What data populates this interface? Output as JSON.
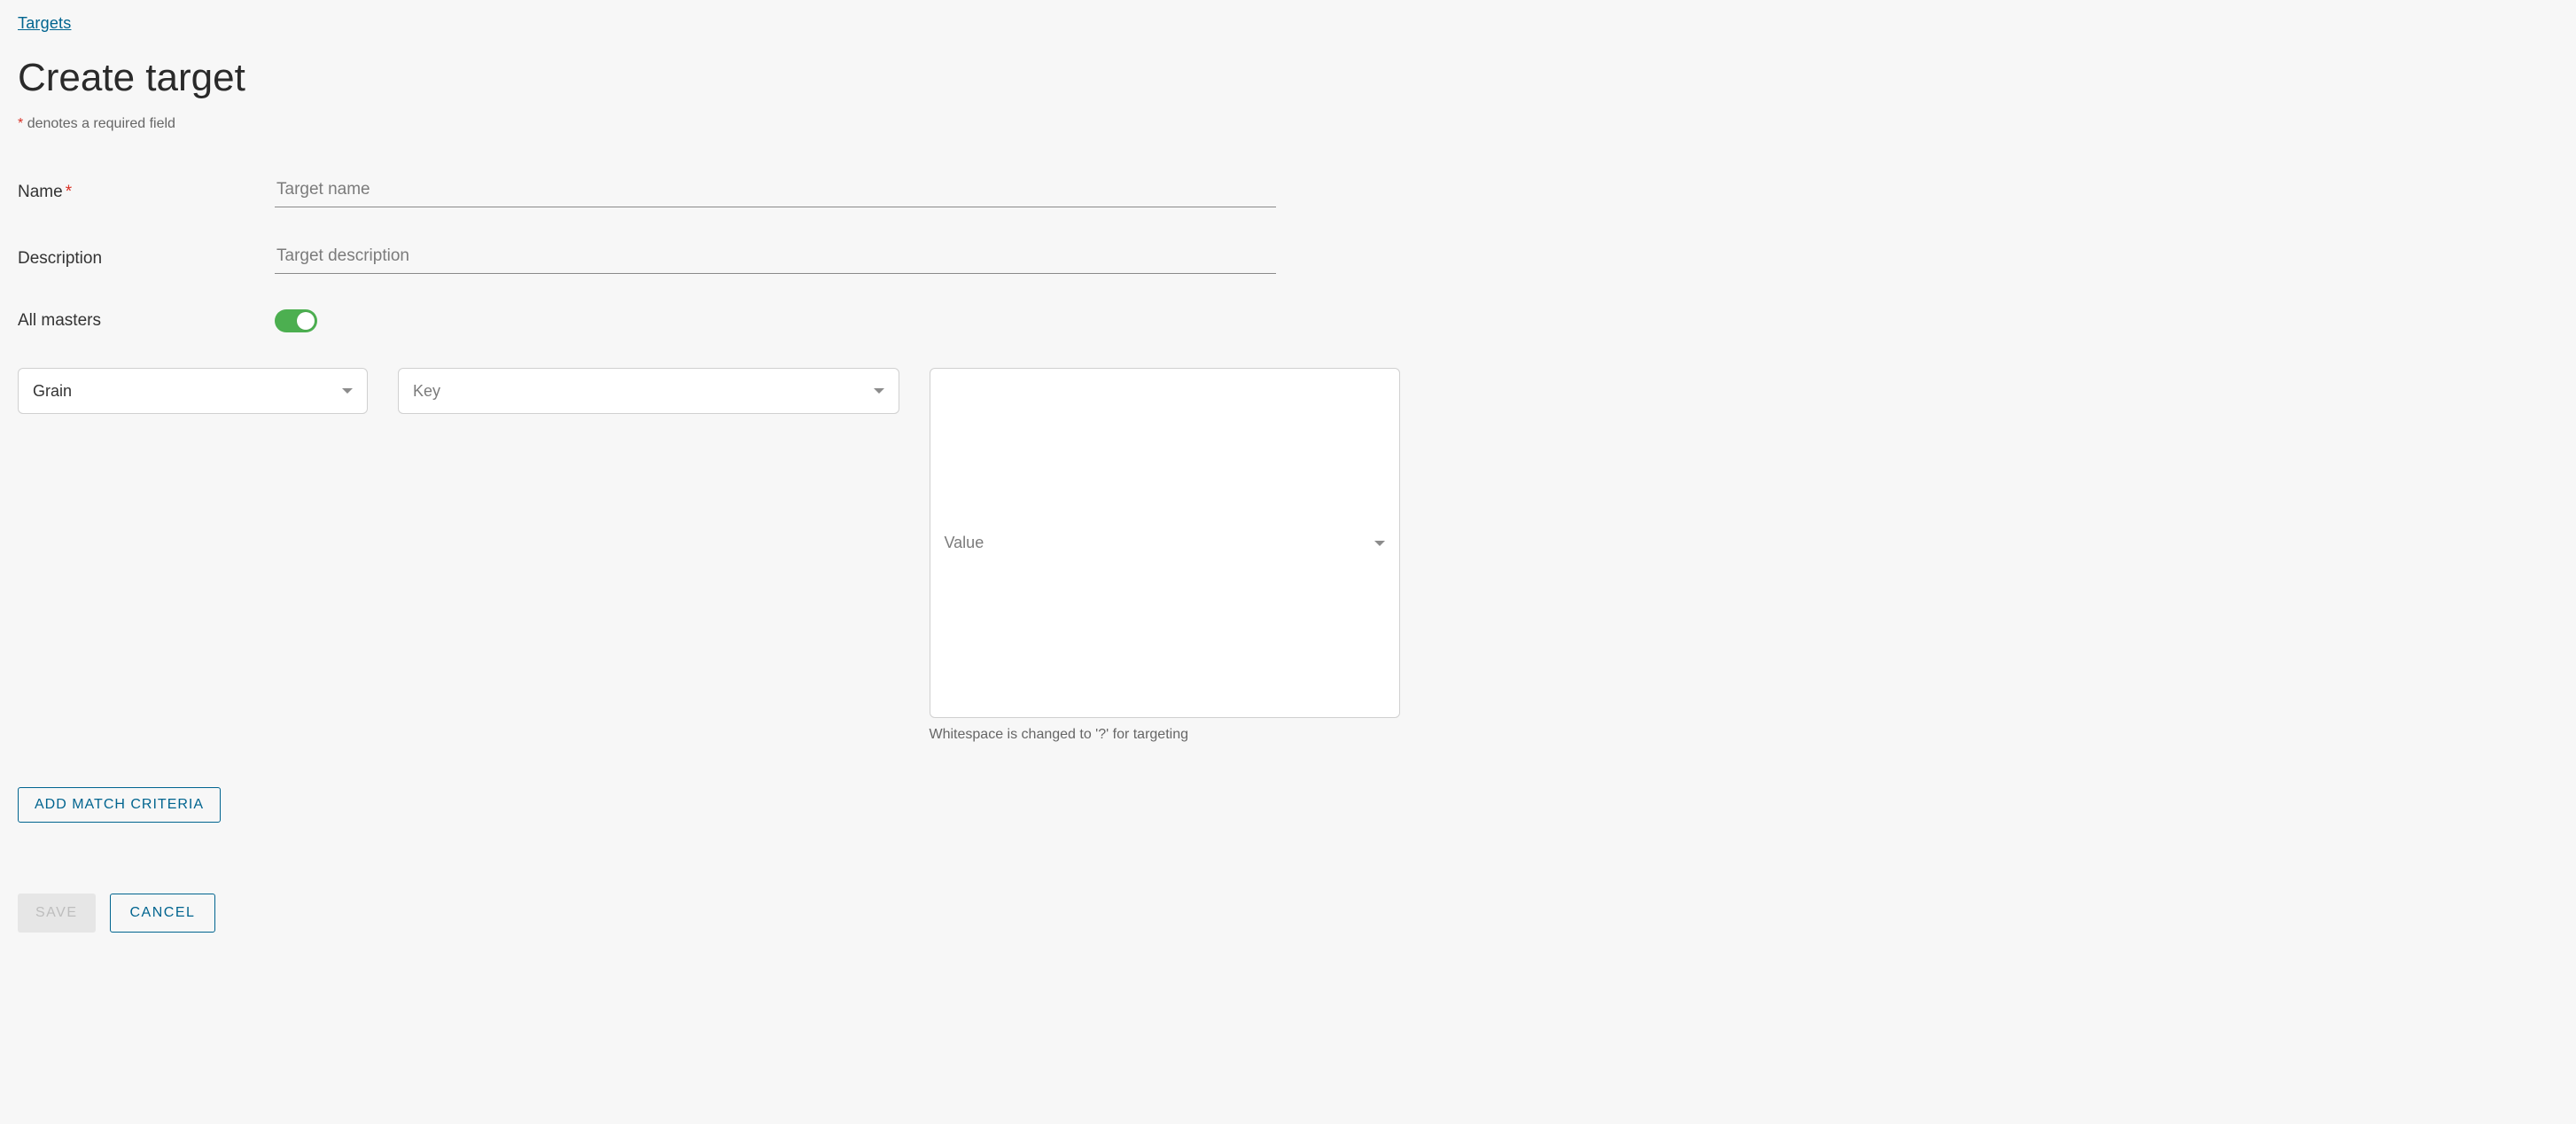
{
  "breadcrumb": {
    "targets": "Targets"
  },
  "page": {
    "title": "Create target",
    "required_note": "denotes a required field"
  },
  "form": {
    "name_label": "Name",
    "name_placeholder": "Target name",
    "name_value": "",
    "description_label": "Description",
    "description_placeholder": "Target description",
    "description_value": "",
    "all_masters_label": "All masters",
    "all_masters_on": true
  },
  "criteria": {
    "type_value": "Grain",
    "key_placeholder": "Key",
    "value_placeholder": "Value",
    "value_helper": "Whitespace is changed to '?' for targeting"
  },
  "buttons": {
    "add_match": "ADD MATCH CRITERIA",
    "save": "SAVE",
    "cancel": "CANCEL"
  }
}
